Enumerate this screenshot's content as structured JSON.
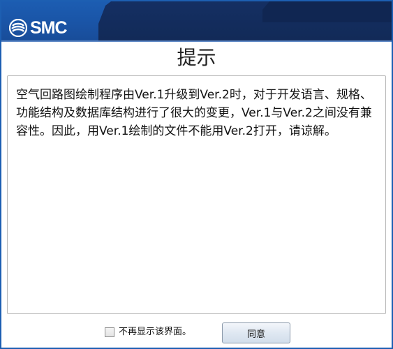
{
  "header": {
    "logo_text": "SMC"
  },
  "dialog": {
    "title": "提示",
    "message": "空气回路图绘制程序由Ver.1升级到Ver.2时，对于开发语言、规格、功能结构及数据库结构进行了很大的变更，Ver.1与Ver.2之间没有兼容性。因此，用Ver.1绘制的文件不能用Ver.2打开，请谅解。"
  },
  "footer": {
    "dont_show_label": "不再显示该界面。",
    "dont_show_checked": false,
    "agree_label": "同意"
  },
  "colors": {
    "header_blue": "#1c5db2",
    "header_dark": "#142f63",
    "border_blue": "#1d5fb2"
  },
  "icons": {
    "logo": "smc-logo-icon",
    "checkbox": "checkbox-icon"
  }
}
